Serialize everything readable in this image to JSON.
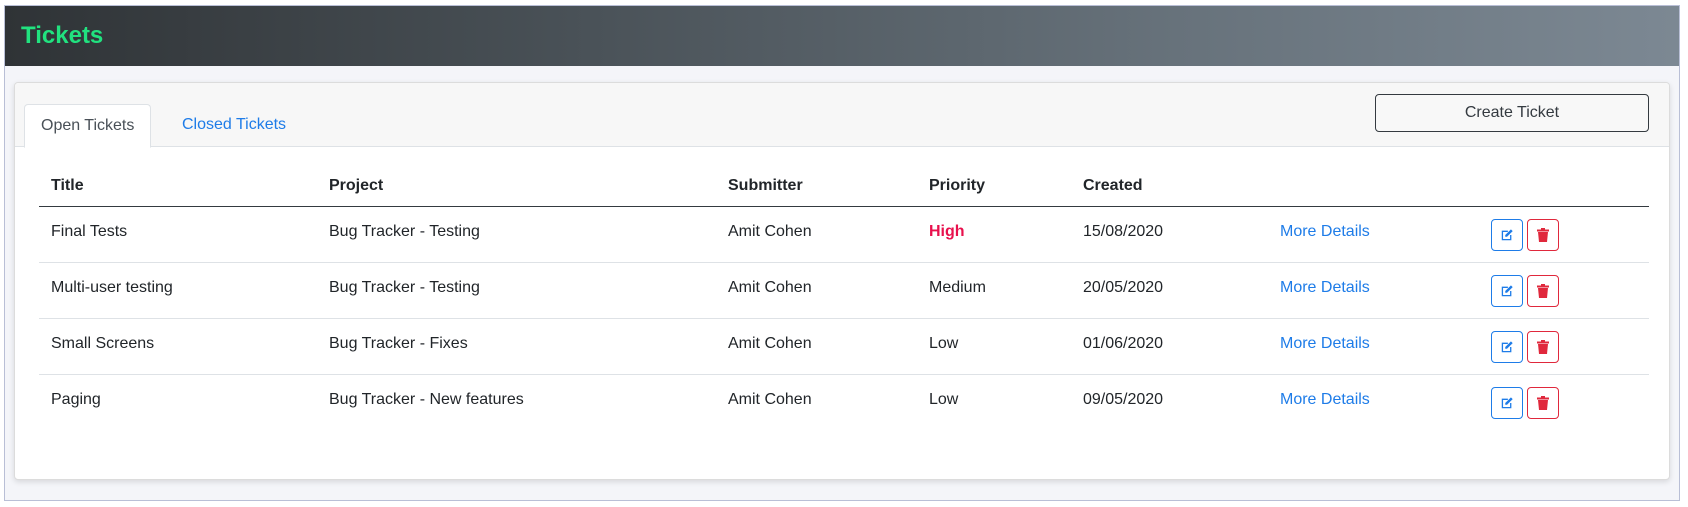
{
  "header": {
    "title": "Tickets"
  },
  "tabs": [
    {
      "label": "Open Tickets"
    },
    {
      "label": "Closed Tickets"
    }
  ],
  "create_button": "Create Ticket",
  "table": {
    "columns": [
      "Title",
      "Project",
      "Submitter",
      "Priority",
      "Created"
    ],
    "rows": [
      {
        "title": "Final Tests",
        "project": "Bug Tracker - Testing",
        "submitter": "Amit Cohen",
        "priority": "High",
        "created": "15/08/2020",
        "details": "More Details"
      },
      {
        "title": "Multi-user testing",
        "project": "Bug Tracker - Testing",
        "submitter": "Amit Cohen",
        "priority": "Medium",
        "created": "20/05/2020",
        "details": "More Details"
      },
      {
        "title": "Small Screens",
        "project": "Bug Tracker - Fixes",
        "submitter": "Amit Cohen",
        "priority": "Low",
        "created": "01/06/2020",
        "details": "More Details"
      },
      {
        "title": "Paging",
        "project": "Bug Tracker - New features",
        "submitter": "Amit Cohen",
        "priority": "Low",
        "created": "09/05/2020",
        "details": "More Details"
      }
    ]
  },
  "icons": {
    "edit": "edit-icon",
    "delete": "trash-icon"
  },
  "colors": {
    "accent": "#1e7ce8",
    "danger": "#e0283c",
    "high_priority": "#e8114d",
    "title_green": "#21e27f"
  }
}
